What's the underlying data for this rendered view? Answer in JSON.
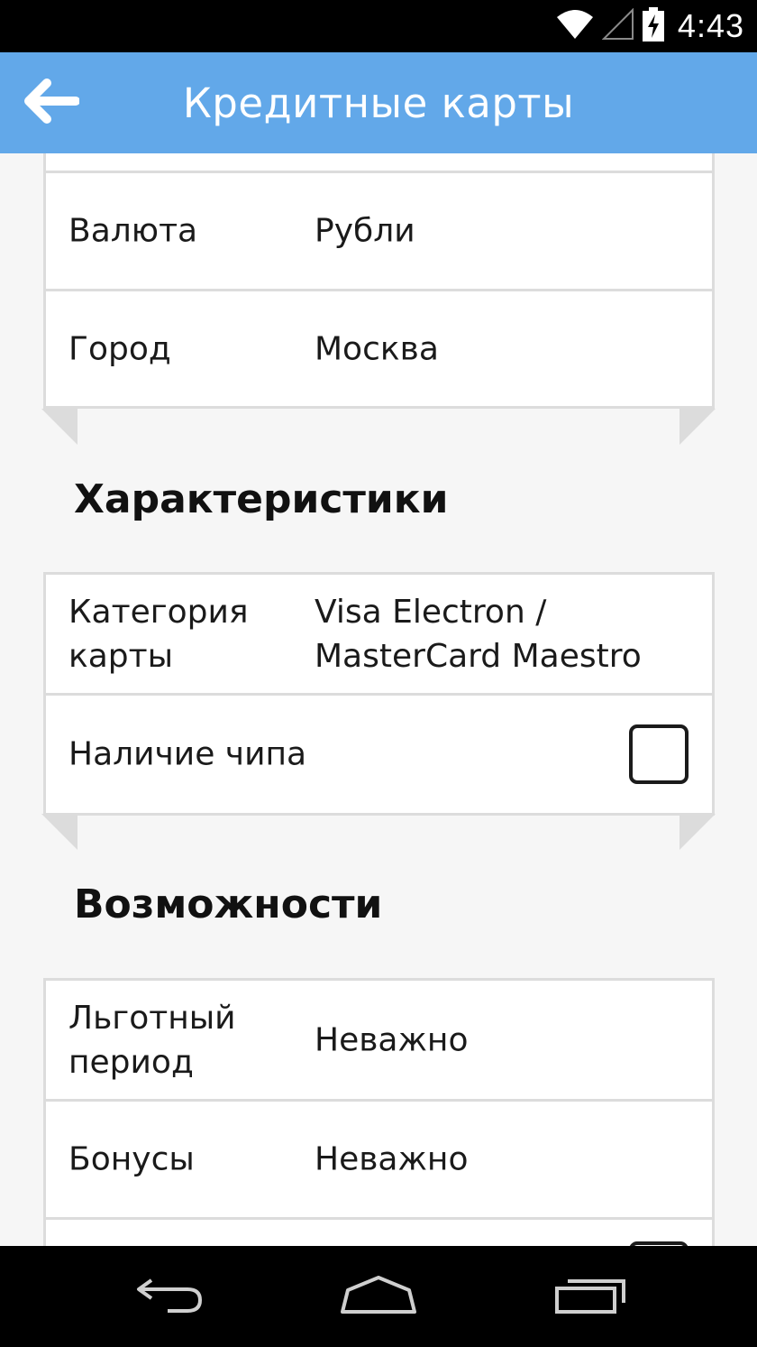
{
  "status_bar": {
    "time": "4:43",
    "icons": [
      "wifi-icon",
      "cell-signal-icon",
      "battery-charging-icon"
    ]
  },
  "app_bar": {
    "title": "Кредитные карты",
    "back_icon": "arrow-left-icon"
  },
  "general_card": {
    "rows": [
      {
        "label": "Валюта",
        "value": "Рубли"
      },
      {
        "label": "Город",
        "value": "Москва"
      }
    ]
  },
  "characteristics": {
    "title": "Характеристики",
    "rows": [
      {
        "label": "Категория\nкарты",
        "value": "Visa Electron /\nMasterCard Maestro"
      },
      {
        "label": "Наличие чипа",
        "checked": false
      }
    ]
  },
  "features": {
    "title": "Возможности",
    "rows": [
      {
        "label": "Льготный\nпериод",
        "value": "Неважно"
      },
      {
        "label": "Бонусы",
        "value": "Неважно"
      }
    ]
  },
  "nav_bar": {
    "icons": [
      "back-nav-icon",
      "home-nav-icon",
      "recents-nav-icon"
    ]
  },
  "colors": {
    "app_bar": "#62a8e9",
    "background": "#f6f6f6",
    "card_border": "#dcdcdc"
  }
}
